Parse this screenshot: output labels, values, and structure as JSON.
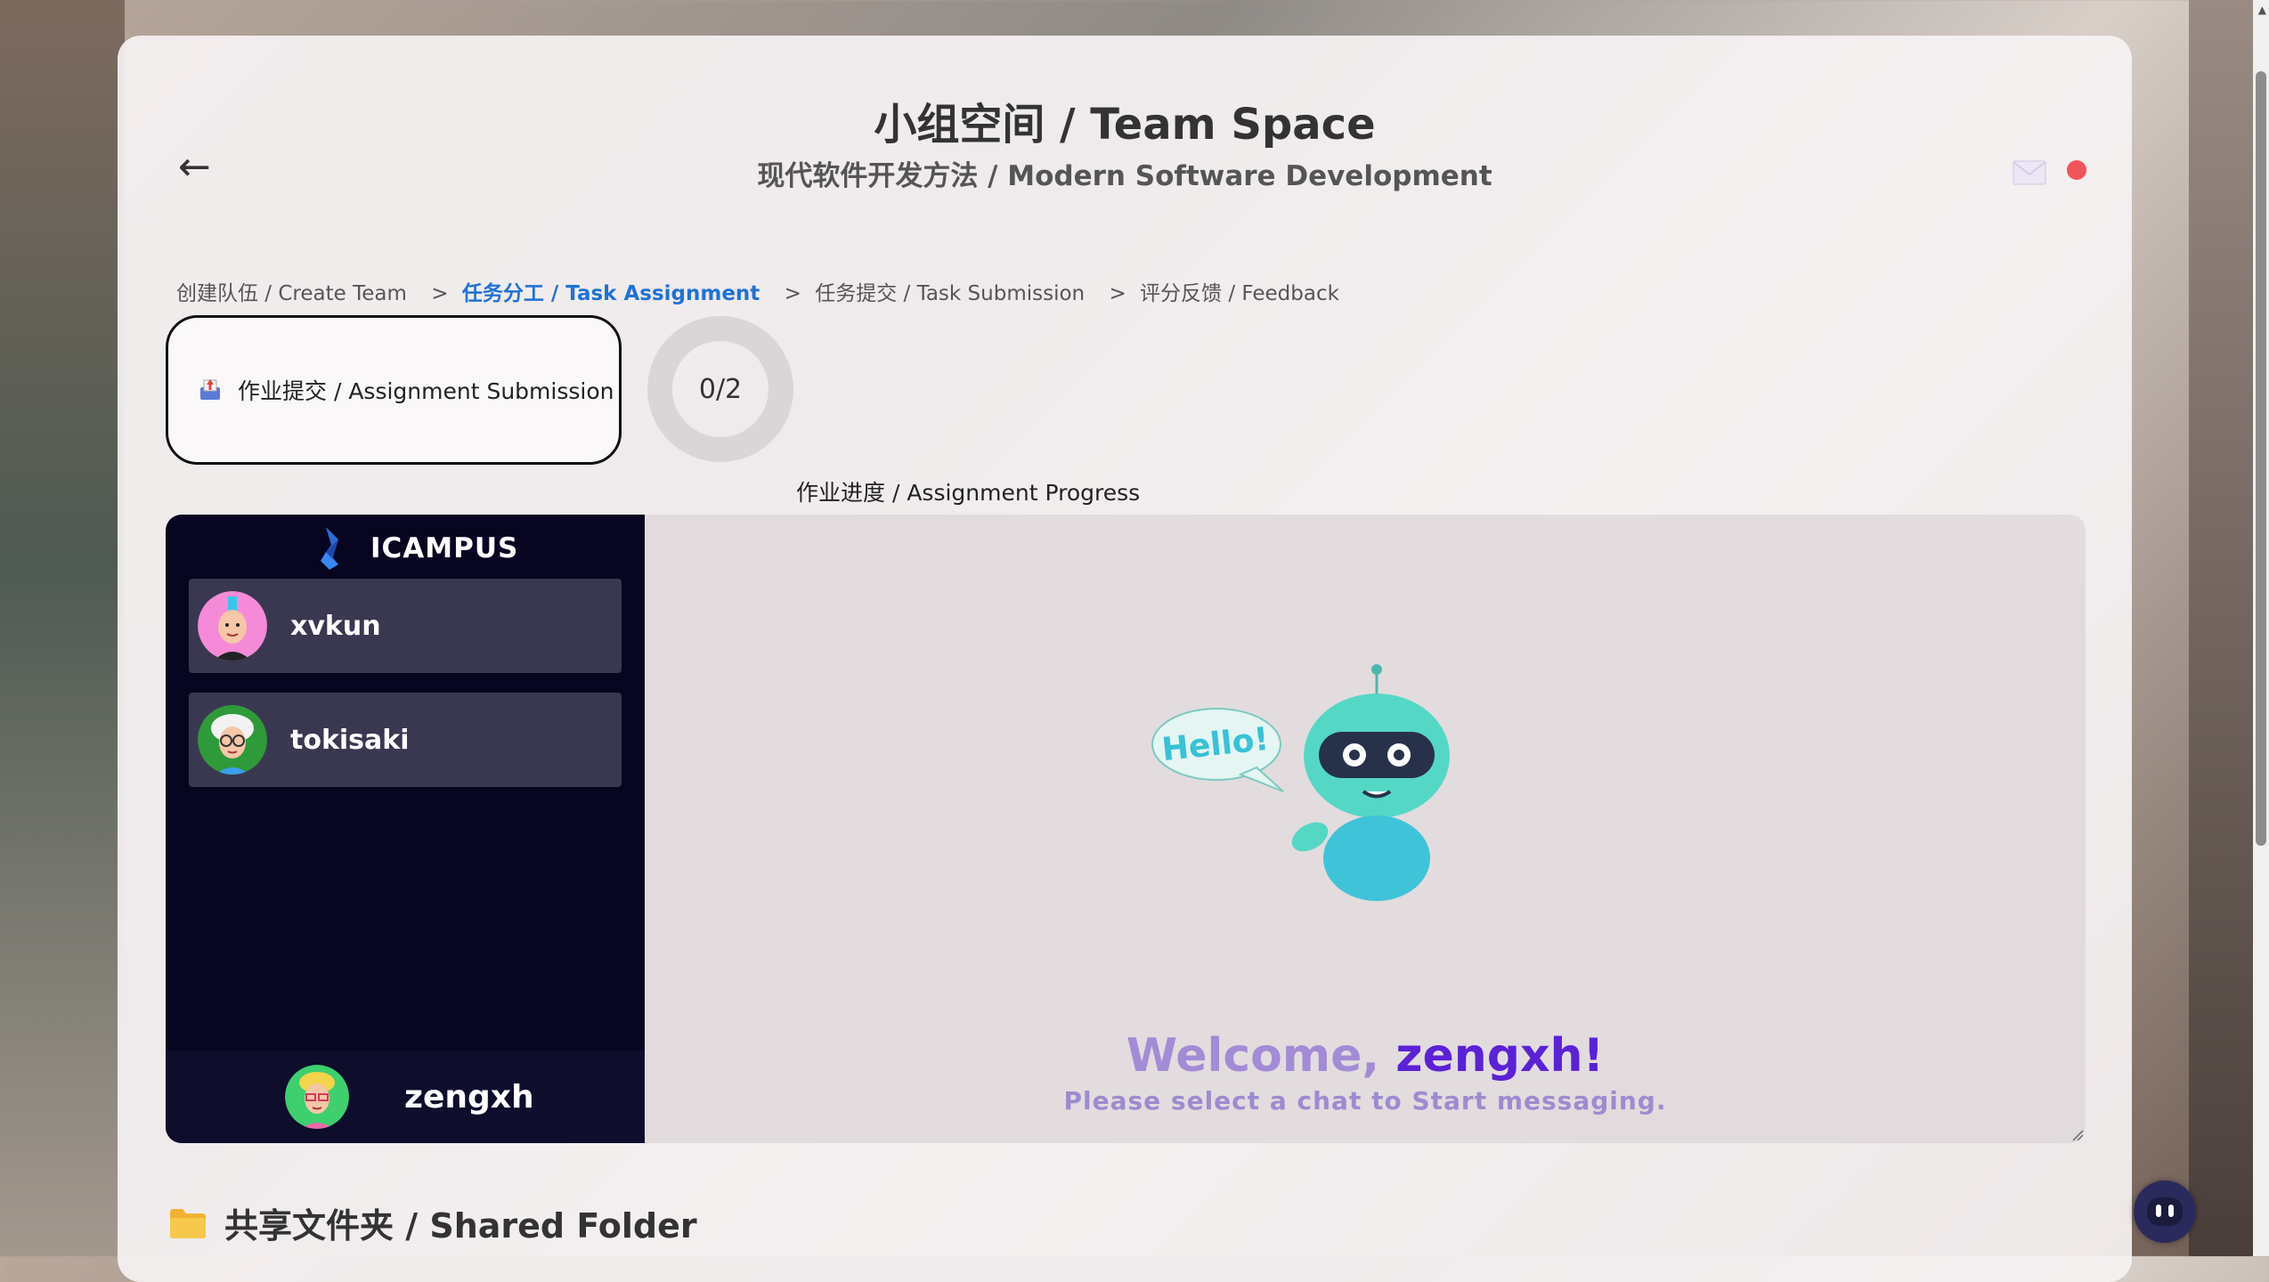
{
  "header": {
    "back_label": "←",
    "title": "小组空间 / Team Space",
    "subtitle": "现代软件开发方法 / Modern Software Development"
  },
  "steps": [
    {
      "label": "创建队伍 / Create Team",
      "active": false
    },
    {
      "label": "任务分工 / Task Assignment",
      "active": true
    },
    {
      "label": "任务提交 / Task Submission",
      "active": false
    },
    {
      "label": "评分反馈 / Feedback",
      "active": false
    }
  ],
  "step_separator": ">",
  "submission": {
    "button_label": "作业提交 / Assignment Submission",
    "icon": "inbox-upload-icon"
  },
  "progress": {
    "text": "0/2",
    "completed": 0,
    "total": 2,
    "label": "作业进度 / Assignment Progress"
  },
  "chat": {
    "brand": "ICAMPUS",
    "contacts": [
      {
        "name": "xvkun",
        "avatar": "avatar-pink-mohawk"
      },
      {
        "name": "tokisaki",
        "avatar": "avatar-white-hair-glasses"
      }
    ],
    "current_user": {
      "name": "zengxh",
      "avatar": "avatar-blonde-glasses"
    },
    "welcome_prefix": "Welcome, ",
    "welcome_user": "zengxh!",
    "hint": "Please select a chat to Start messaging.",
    "robot_bubble": "Hello!"
  },
  "shared_folder": {
    "title": "共享文件夹 / Shared Folder",
    "icon": "folder-icon"
  },
  "colors": {
    "active_step": "#1f72d6",
    "sidebar_bg": "#070520",
    "welcome_accent": "#5b21d6",
    "notify_dot": "#f2545b"
  }
}
